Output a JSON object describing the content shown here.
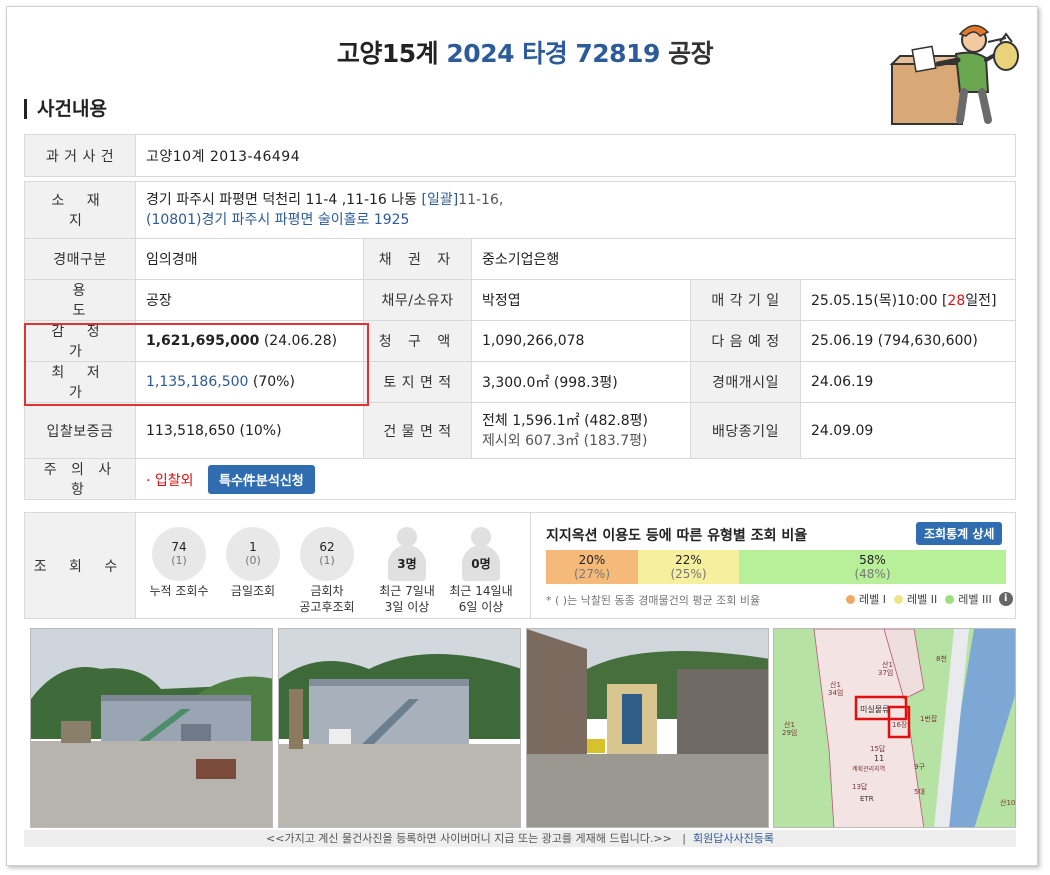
{
  "header": {
    "court": "고양15계",
    "case_no": "2024 타경 72819",
    "item_type": "공장"
  },
  "section_title": "사건내용",
  "past_case": {
    "label": "과 거 사 건",
    "value": "고양10계 2013-46494"
  },
  "location": {
    "label": "소 재 지",
    "address": "경기 파주시 파평면 덕천리 11-4 ,11-16 나동",
    "bulk": "[일괄]",
    "bulk_rest": "11-16,",
    "road_address": "(10801)경기 파주시  파평면 술이홀로  1925"
  },
  "rows": {
    "auction_type": {
      "label": "경매구분",
      "value": "임의경매"
    },
    "creditor": {
      "label": "채 권 자",
      "value": "중소기업은행"
    },
    "usage": {
      "label": "용 도",
      "value": "공장"
    },
    "debtor": {
      "label": "채무/소유자",
      "value": "박정엽"
    },
    "sale_date": {
      "label": "매 각 기 일",
      "value": "25.05.15(목)10:00 [",
      "days": "28",
      "days_suffix": "일전]"
    },
    "appraisal": {
      "label": "감 정 가",
      "value": "1,621,695,000",
      "date": "(24.06.28)"
    },
    "claim": {
      "label": "청 구 액",
      "value": "1,090,266,078"
    },
    "next": {
      "label": "다 음 예 정",
      "value": "25.06.19 (794,630,600)"
    },
    "minimum": {
      "label": "최 저 가",
      "value": "1,135,186,500",
      "pct": "(70%)"
    },
    "land_area": {
      "label": "토 지 면 적",
      "value": "3,300.0㎡ (998.3평)"
    },
    "start_date": {
      "label": "경매개시일",
      "value": "24.06.19"
    },
    "deposit": {
      "label": "입찰보증금",
      "value": "113,518,650 (10%)"
    },
    "building_area": {
      "label": "건 물 면 적",
      "value": "전체 1,596.1㎡ (482.8평)",
      "excluded": "제시외 607.3㎡ (183.7평)"
    },
    "dividend_deadline": {
      "label": "배당종기일",
      "value": "24.09.09"
    },
    "caution": {
      "label": "주 의 사 항",
      "value": "· 입찰외",
      "button": "특수件분석신청"
    }
  },
  "views": {
    "label": "조 회 수",
    "stats": [
      {
        "n": "74",
        "s": "(1)",
        "cap1": "누적 조회수",
        "cap2": ""
      },
      {
        "n": "1",
        "s": "(0)",
        "cap1": "금일조회",
        "cap2": ""
      },
      {
        "n": "62",
        "s": "(1)",
        "cap1": "금회차",
        "cap2": "공고후조회"
      }
    ],
    "people": [
      {
        "n": "3명",
        "cap1": "최근 7일내",
        "cap2": "3일 이상"
      },
      {
        "n": "0명",
        "cap1": "최근 14일내",
        "cap2": "6일 이상"
      }
    ],
    "ratio_title": "지지옥션 이용도 등에 따른 유형별 조회 비율",
    "stats_button": "조회통계 상세",
    "bars": [
      {
        "pct": 20,
        "sub": "(27%)",
        "label": "20%",
        "color": "#f5b97a"
      },
      {
        "pct": 22,
        "sub": "(25%)",
        "label": "22%",
        "color": "#f5ef9e"
      },
      {
        "pct": 58,
        "sub": "(48%)",
        "label": "58%",
        "color": "#b8f09a"
      }
    ],
    "note": "* ( )는 낙찰된 동종 경매물건의 평균 조회 비율",
    "legend": [
      {
        "label": "레벨 I",
        "color": "#f0a868"
      },
      {
        "label": "레벨 II",
        "color": "#ede48a"
      },
      {
        "label": "레벨 III",
        "color": "#9de07a"
      }
    ]
  },
  "map": {
    "lot_marker": "미실물류",
    "labels": [
      "산1\n37임",
      "산1\n34임",
      "산1\n29임",
      "15답",
      "11",
      "계획관리지역",
      "13답",
      "ETR",
      "8천",
      "산10",
      "16장",
      "1번잡",
      "9구",
      "5대"
    ]
  },
  "footer": {
    "notice": "<<가지고 계신 물건사진을 등록하면 사이버머니 지급 또는 광고를 게재해 드립니다.>>",
    "link": "회원답사사진등록"
  }
}
